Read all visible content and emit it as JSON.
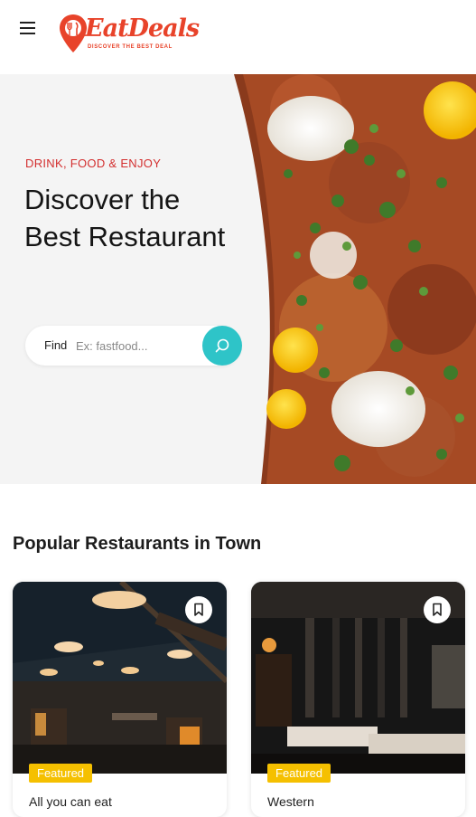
{
  "header": {
    "menu_icon": "hamburger-menu-icon",
    "logo_text": "EatDeals",
    "logo_tagline": "DISCOVER THE BEST DEAL",
    "brand_color": "#e8432a"
  },
  "hero": {
    "eyebrow": "DRINK, FOOD & ENJOY",
    "title": "Discover the Best Restaurant",
    "search": {
      "label": "Find",
      "placeholder": "Ex: fastfood...",
      "button_icon": "search-icon",
      "accent": "#2ec4c8"
    }
  },
  "popular": {
    "title": "Popular Restaurants in Town",
    "cards": [
      {
        "badge": "Featured",
        "name": "All you can eat",
        "bookmark_icon": "bookmark-icon"
      },
      {
        "badge": "Featured",
        "name": "Western",
        "bookmark_icon": "bookmark-icon"
      }
    ]
  }
}
